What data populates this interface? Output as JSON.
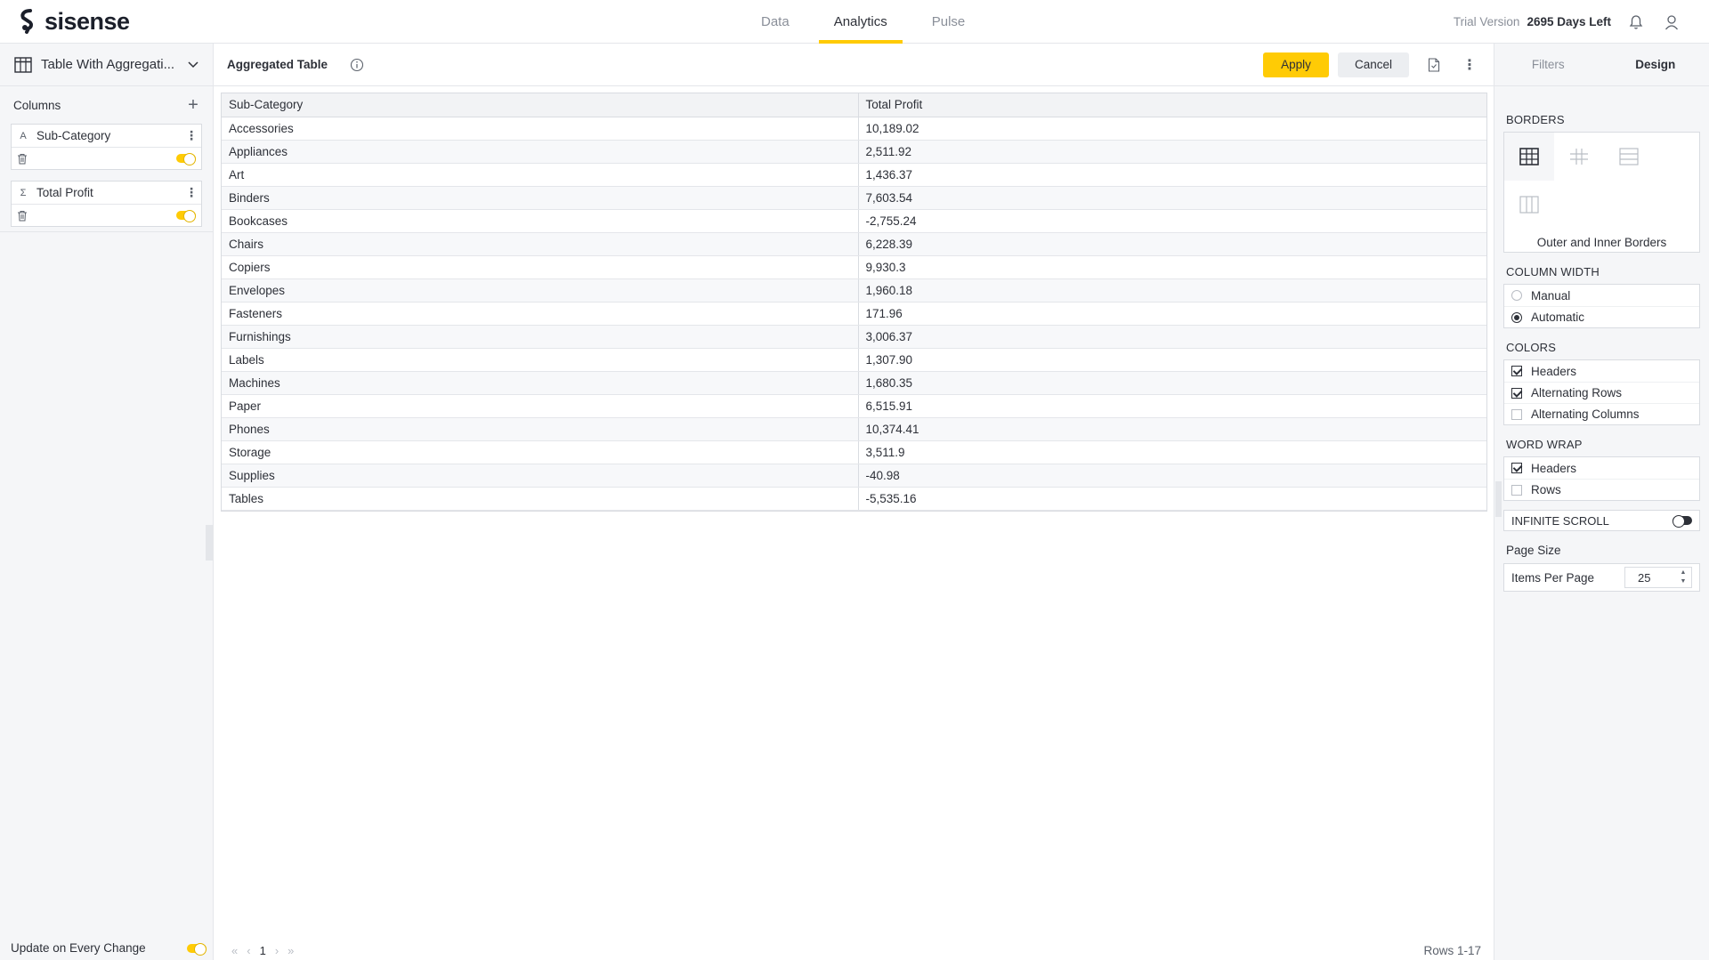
{
  "brand": {
    "name": "sisense",
    "accent": "#ffcb05"
  },
  "nav": {
    "tabs": [
      {
        "label": "Data"
      },
      {
        "label": "Analytics"
      },
      {
        "label": "Pulse"
      }
    ],
    "active": "Analytics"
  },
  "trial": {
    "label": "Trial Version",
    "days": "2695 Days Left"
  },
  "icons": {
    "notifications": "bell-icon",
    "user": "user-icon"
  },
  "left_panel": {
    "widget_selector": "Table With Aggregati...",
    "columns_label": "Columns",
    "columns": [
      {
        "type_icon": "A",
        "name": "Sub-Category",
        "enabled": true
      },
      {
        "type_icon": "Σ",
        "name": "Total Profit",
        "enabled": true
      }
    ],
    "update_label": "Update on Every Change",
    "update_enabled": true
  },
  "main": {
    "title": "Aggregated Table",
    "apply_label": "Apply",
    "cancel_label": "Cancel",
    "table": {
      "headers": [
        "Sub-Category",
        "Total Profit"
      ],
      "rows": [
        [
          "Accessories",
          "10,189.02"
        ],
        [
          "Appliances",
          "2,511.92"
        ],
        [
          "Art",
          "1,436.37"
        ],
        [
          "Binders",
          "7,603.54"
        ],
        [
          "Bookcases",
          "-2,755.24"
        ],
        [
          "Chairs",
          "6,228.39"
        ],
        [
          "Copiers",
          "9,930.3"
        ],
        [
          "Envelopes",
          "1,960.18"
        ],
        [
          "Fasteners",
          "171.96"
        ],
        [
          "Furnishings",
          "3,006.37"
        ],
        [
          "Labels",
          "1,307.90"
        ],
        [
          "Machines",
          "1,680.35"
        ],
        [
          "Paper",
          "6,515.91"
        ],
        [
          "Phones",
          "10,374.41"
        ],
        [
          "Storage",
          "3,511.9"
        ],
        [
          "Supplies",
          "-40.98"
        ],
        [
          "Tables",
          "-5,535.16"
        ]
      ]
    },
    "pager": {
      "first": "«",
      "prev": "‹",
      "page": "1",
      "next": "›",
      "last": "»"
    },
    "rows_info": "Rows 1-17"
  },
  "design_panel": {
    "tabs": [
      {
        "label": "Filters"
      },
      {
        "label": "Design"
      }
    ],
    "active_tab": "Design",
    "borders": {
      "title": "BORDERS",
      "selected_caption": "Outer and Inner Borders"
    },
    "column_width": {
      "title": "COLUMN WIDTH",
      "options": [
        "Manual",
        "Automatic"
      ],
      "selected": "Automatic"
    },
    "colors": {
      "title": "COLORS",
      "options": [
        {
          "label": "Headers",
          "checked": true
        },
        {
          "label": "Alternating Rows",
          "checked": true
        },
        {
          "label": "Alternating Columns",
          "checked": false
        }
      ]
    },
    "word_wrap": {
      "title": "WORD WRAP",
      "options": [
        {
          "label": "Headers",
          "checked": true
        },
        {
          "label": "Rows",
          "checked": false
        }
      ]
    },
    "infinite_scroll": {
      "label": "INFINITE SCROLL",
      "enabled": false
    },
    "page_size": {
      "title": "Page Size",
      "items_label": "Items Per Page",
      "value": "25"
    }
  }
}
